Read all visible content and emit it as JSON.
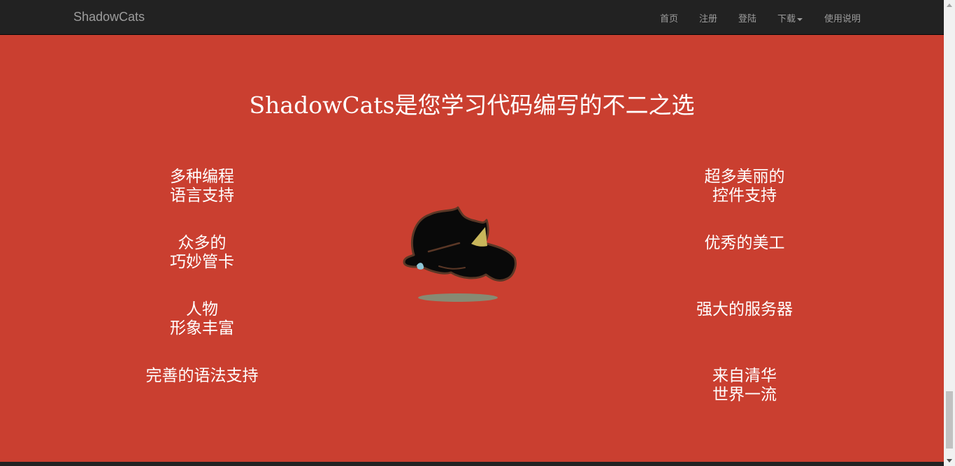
{
  "navbar": {
    "brand": "ShadowCats",
    "items": [
      "首页",
      "注册",
      "登陆",
      "下载",
      "使用说明"
    ]
  },
  "main": {
    "headline": "ShadowCats是您学习代码编写的不二之选",
    "left_features": [
      [
        "多种编程",
        "语言支持"
      ],
      [
        "众多的",
        "巧妙管卡"
      ],
      [
        "人物",
        "形象丰富"
      ],
      [
        "完善的语法支持"
      ]
    ],
    "right_features": [
      [
        "超多美丽的",
        "控件支持"
      ],
      [
        "优秀的美工"
      ],
      [
        "强大的服务器"
      ],
      [
        "来自清华",
        "世界一流"
      ]
    ]
  },
  "colors": {
    "navbar_bg": "#222222",
    "nav_text": "#9d9d9d",
    "page_bg": "#ca3f30",
    "text": "#ffffff"
  },
  "icons": {
    "cat": "sleeping-black-cat-illustration",
    "dropdown": "caret-down-icon"
  }
}
